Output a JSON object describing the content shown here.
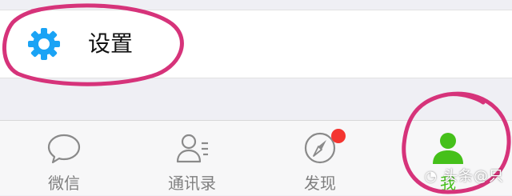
{
  "settings_row": {
    "label": "设置",
    "icon": "gear-icon",
    "icon_color": "#1aa3f5"
  },
  "tabbar": {
    "tabs": [
      {
        "label": "微信",
        "icon": "chat-bubble-icon",
        "active": false
      },
      {
        "label": "通讯录",
        "icon": "contacts-icon",
        "active": false
      },
      {
        "label": "发现",
        "icon": "compass-icon",
        "active": false,
        "badge": true
      },
      {
        "label": "我",
        "icon": "person-icon",
        "active": true
      }
    ],
    "inactive_color": "#7f7f7f",
    "active_color": "#45c01a",
    "badge_color": "#f43530"
  },
  "annotation_color": "#d6337a",
  "watermark": {
    "label": "头条@只",
    "icon": "toutiao-logo-icon"
  }
}
